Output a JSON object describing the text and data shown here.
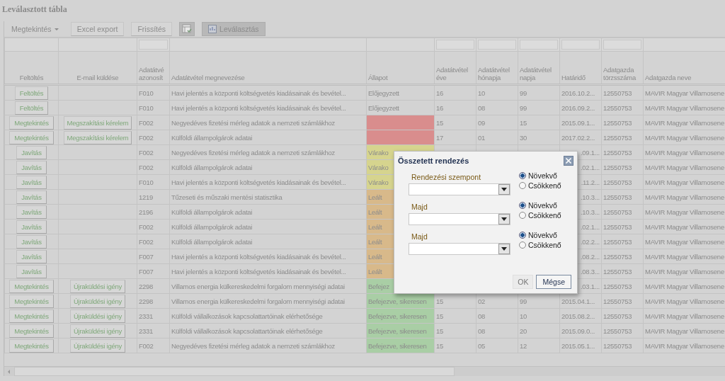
{
  "title": "Leválasztott tábla",
  "toolbar": [
    {
      "kind": "menu",
      "label": "Megtekintés",
      "disabled": false
    },
    {
      "kind": "button",
      "label": "Excel export",
      "disabled": false
    },
    {
      "kind": "button",
      "label": "Frissítés",
      "disabled": false
    },
    {
      "kind": "icon",
      "disabled": true
    },
    {
      "kind": "icon-button",
      "label": "Leválasztás",
      "disabled": true
    }
  ],
  "columns": [
    {
      "label": "Feltöltés",
      "filter": false
    },
    {
      "label": "E-mail küldése",
      "filter": false
    },
    {
      "label": "Adatátvé azonosít",
      "filter": true
    },
    {
      "label": "Adatátvétel megnevezése",
      "filter": false
    },
    {
      "label": "Állapot",
      "filter": false
    },
    {
      "label": "Adatátvétel éve",
      "filter": true
    },
    {
      "label": "Adatátvétel hónapja",
      "filter": true
    },
    {
      "label": "Adatátvétel napja",
      "filter": true
    },
    {
      "label": "Határidő",
      "filter": true
    },
    {
      "label": "Adatgazda törzsszáma",
      "filter": true
    },
    {
      "label": "Adatgazda neve",
      "filter": false
    }
  ],
  "rows": [
    {
      "action": "Feltöltés",
      "id": "F010",
      "name": "Havi jelentés a központi költségvetés kiadásainak és bevétel...",
      "status": "Előjegyzett",
      "year": "16",
      "month": "10",
      "day": "99",
      "deadline": "2016.10.2...",
      "owner_id": "12550753",
      "owner": "MAVIR Magyar Villamosene"
    },
    {
      "action": "Feltöltés",
      "id": "F010",
      "name": "Havi jelentés a központi költségvetés kiadásainak és bevétel...",
      "status": "Előjegyzett",
      "year": "16",
      "month": "08",
      "day": "99",
      "deadline": "2016.09.2...",
      "owner_id": "12550753",
      "owner": "MAVIR Magyar Villamosene"
    },
    {
      "action": "Megtekintés",
      "email": "Megszakítási kérelem",
      "id": "F002",
      "name": "Negyedéves fizetési mérleg adatok a nemzeti számlákhoz",
      "color": "#d98d8d",
      "year": "15",
      "month": "09",
      "day": "15",
      "deadline": "2015.09.1...",
      "owner_id": "12550753",
      "owner": "MAVIR Magyar Villamosene"
    },
    {
      "action": "Megtekintés",
      "email": "Megszakítási kérelem",
      "id": "F002",
      "name": "Külföldi állampolgárok adatai",
      "color": "#d98d8d",
      "year": "17",
      "month": "01",
      "day": "30",
      "deadline": "2017.02.2...",
      "owner_id": "12550753",
      "owner": "MAVIR Magyar Villamosene"
    },
    {
      "action": "Javítás",
      "id": "F002",
      "name": "Negyedéves fizetési mérleg adatok a nemzeti számlákhoz",
      "status": "Várako",
      "color": "#d6d48e",
      "deadline": ".09.1...",
      "owner_id": "12550753",
      "owner": "MAVIR Magyar Villamosene"
    },
    {
      "action": "Javítás",
      "id": "F002",
      "name": "Külföldi állampolgárok adatai",
      "status": "Várako",
      "color": "#d6d48e",
      "deadline": ".02.1...",
      "owner_id": "12550753",
      "owner": "MAVIR Magyar Villamosene"
    },
    {
      "action": "Javítás",
      "id": "F010",
      "name": "Havi jelentés a központi költségvetés kiadásainak és bevétel...",
      "status": "Várako",
      "color": "#d6d48e",
      "deadline": ".11.2...",
      "owner_id": "12550753",
      "owner": "MAVIR Magyar Villamosene"
    },
    {
      "action": "Javítás",
      "id": "1219",
      "name": "Tűzeseti és műszaki mentési statisztika",
      "status": "Leált",
      "color": "#d8b98a",
      "deadline": ".10.3...",
      "owner_id": "12550753",
      "owner": "MAVIR Magyar Villamosene"
    },
    {
      "action": "Javítás",
      "id": "2196",
      "name": "Külföldi állampolgárok adatai",
      "status": "Leált",
      "color": "#d8b98a",
      "deadline": ".10.3...",
      "owner_id": "12550753",
      "owner": "MAVIR Magyar Villamosene"
    },
    {
      "action": "Javítás",
      "id": "F002",
      "name": "Külföldi állampolgárok adatai",
      "status": "Leált",
      "color": "#d8b98a",
      "deadline": ".02.1...",
      "owner_id": "12550753",
      "owner": "MAVIR Magyar Villamosene"
    },
    {
      "action": "Javítás",
      "id": "F002",
      "name": "Külföldi állampolgárok adatai",
      "status": "Leált",
      "color": "#d8b98a",
      "deadline": ".02.2...",
      "owner_id": "12550753",
      "owner": "MAVIR Magyar Villamosene"
    },
    {
      "action": "Javítás",
      "id": "F007",
      "name": "Havi jelentés a központi költségvetés kiadásainak és bevétel...",
      "status": "Leált",
      "color": "#d8b98a",
      "deadline": ".08.2...",
      "owner_id": "12550753",
      "owner": "MAVIR Magyar Villamosene"
    },
    {
      "action": "Javítás",
      "id": "F007",
      "name": "Havi jelentés a központi költségvetés kiadásainak és bevétel...",
      "status": "Leált",
      "color": "#d8b98a",
      "deadline": ".08.3...",
      "owner_id": "12550753",
      "owner": "MAVIR Magyar Villamosene"
    },
    {
      "action": "Megtekintés",
      "email": "Újraküldési igény",
      "id": "2298",
      "name": "Villamos energia külkereskedelmi forgalom mennyiségi adatai",
      "status": "Befejez",
      "color": "#a9cea5",
      "deadline": ".03.1...",
      "owner_id": "12550753",
      "owner": "MAVIR Magyar Villamosene"
    },
    {
      "action": "Megtekintés",
      "email": "Újraküldési igény",
      "id": "2298",
      "name": "Villamos energia külkereskedelmi forgalom mennyiségi adatai",
      "status": "Befejezve, sikeresen",
      "color": "#a9cea5",
      "year": "15",
      "month": "02",
      "day": "99",
      "deadline": "2015.04.1...",
      "owner_id": "12550753",
      "owner": "MAVIR Magyar Villamosene"
    },
    {
      "action": "Megtekintés",
      "email": "Újraküldési igény",
      "id": "2331",
      "name": "Külföldi vállalkozások kapcsolattartóinak elérhetősége",
      "status": "Befejezve, sikeresen",
      "color": "#a9cea5",
      "year": "15",
      "month": "08",
      "day": "10",
      "deadline": "2015.08.2...",
      "owner_id": "12550753",
      "owner": "MAVIR Magyar Villamosene"
    },
    {
      "action": "Megtekintés",
      "email": "Újraküldési igény",
      "id": "2331",
      "name": "Külföldi vállalkozások kapcsolattartóinak elérhetősége",
      "status": "Befejezve, sikeresen",
      "color": "#a9cea5",
      "year": "15",
      "month": "08",
      "day": "20",
      "deadline": "2015.09.0...",
      "owner_id": "12550753",
      "owner": "MAVIR Magyar Villamosene"
    },
    {
      "action": "Megtekintés",
      "email": "Újraküldési igény",
      "id": "F002",
      "name": "Negyedéves fizetési mérleg adatok a nemzeti számlákhoz",
      "status": "Befejezve, sikeresen",
      "color": "#a9cea5",
      "year": "15",
      "month": "05",
      "day": "12",
      "deadline": "2015.05.1...",
      "owner_id": "12550753",
      "owner": "MAVIR Magyar Villamosene"
    }
  ],
  "dialog": {
    "title": "Összetett rendezés",
    "sorts": [
      {
        "label": "Rendezési szempont",
        "options": [
          {
            "label": "Növekvő",
            "selected": true
          },
          {
            "label": "Csökkenő",
            "selected": false
          }
        ]
      },
      {
        "label": "Majd",
        "options": [
          {
            "label": "Növekvő",
            "selected": true
          },
          {
            "label": "Csökkenő",
            "selected": false
          }
        ]
      },
      {
        "label": "Majd",
        "options": [
          {
            "label": "Növekvő",
            "selected": true
          },
          {
            "label": "Csökkenő",
            "selected": false
          }
        ]
      }
    ],
    "buttons": [
      {
        "label": "OK",
        "focused": false
      },
      {
        "label": "Mégse",
        "focused": true
      }
    ]
  }
}
